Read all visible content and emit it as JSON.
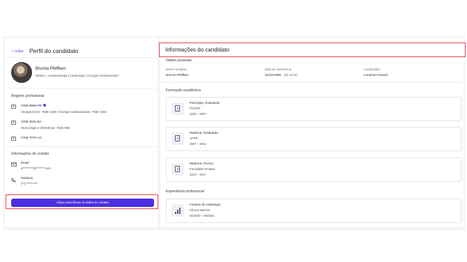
{
  "left": {
    "back_label": "< Voltar",
    "title": "Perfil do candidato",
    "candidate": {
      "name": "Brunno Pfeffken",
      "specialties": "Médico - Anestesiologia | Cardiologia | Cirurgia Cardiovascular"
    },
    "registry": {
      "heading": "Registro profissional",
      "items": [
        {
          "code": "CRM 9999-PR",
          "detail": "Cirurgia Geral - RQE 4168 | Cirurgia Cardiovascular - RQE 4334",
          "verified": true
        },
        {
          "code": "CRM 2525-BA",
          "detail": "Ginecologia e Obstetrícia - RQE 938",
          "verified": false
        },
        {
          "code": "CRM 7070-AC",
          "detail": "",
          "verified": false
        }
      ]
    },
    "contact": {
      "heading": "Informações de contato",
      "email_label": "Email",
      "email_value": "a*********@*******.com",
      "phone_label": "Telefone",
      "phone_value": "(**) *****-****",
      "release_button": "Clique para liberar os dados do contato"
    }
  },
  "right": {
    "title": "Informações do candidato",
    "personal": {
      "heading": "Dados pessoais",
      "name_label": "Nome completo",
      "name_value": "Brunno Pfeffken",
      "birth_label": "Data de nascimento",
      "birth_value": "01/02/1989",
      "age_value": "- (35 anos)",
      "location_label": "Localização",
      "location_value": "Londrina Paraná"
    },
    "education": {
      "heading": "Formação acadêmica",
      "items": [
        {
          "course": "Psicologia, Graduação",
          "school": "PUCPR",
          "period": "2002 – 2007"
        },
        {
          "course": "Medicina, Graduação",
          "school": "UFPR",
          "period": "2007 – 2012"
        },
        {
          "course": "Medicina, Técnico",
          "school": "Faculdade Smasys",
          "period": "2013 – 2017"
        }
      ]
    },
    "experience": {
      "heading": "Experiência profissional",
      "items": [
        {
          "role": "Iniciante de cardiologia",
          "company": "Clínica Mareira",
          "period": "01/2020 – 02/2021"
        }
      ]
    }
  },
  "colors": {
    "accent": "#4c2fe0",
    "highlight_border": "#e8444f",
    "verified_badge": "#5b3fe0"
  },
  "icons": [
    "document-icon",
    "verified-badge-icon",
    "mail-icon",
    "phone-icon",
    "certificate-icon",
    "chart-icon"
  ]
}
